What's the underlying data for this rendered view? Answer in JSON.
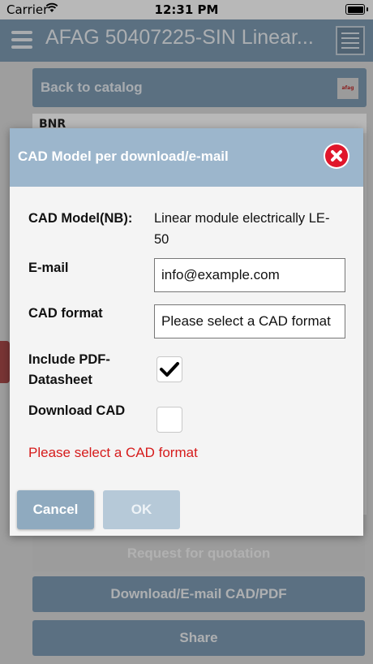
{
  "status_bar": {
    "carrier": "Carrier",
    "time": "12:31 PM",
    "wifi_icon": "wifi-icon",
    "battery_icon": "battery-icon"
  },
  "header": {
    "title": "AFAG 50407225-SIN Linear...",
    "menu_icon": "hamburger-menu-icon",
    "list_icon": "list-view-icon"
  },
  "catalog": {
    "back_label": "Back to catalog",
    "logo_text": "afag"
  },
  "table": {
    "header_label": "BNR"
  },
  "actions": {
    "quote_label": "Request for quotation",
    "download_label": "Download/E-mail CAD/PDF",
    "share_label": "Share"
  },
  "modal": {
    "title": "CAD Model per download/e-mail",
    "close_icon": "close-icon",
    "cad_model_label": "CAD Model(NB):",
    "cad_model_value": "Linear module electrically LE-50",
    "email_label": "E-mail",
    "email_value": "info@example.com",
    "cad_format_label": "CAD format",
    "cad_format_value": "Please select a CAD format",
    "include_pdf_label": "Include PDF-Datasheet",
    "include_pdf_checked": true,
    "download_cad_label": "Download CAD",
    "download_cad_checked": false,
    "error_message": "Please select a CAD format",
    "cancel_label": "Cancel",
    "ok_label": "OK"
  },
  "colors": {
    "header_blue": "#7e9bb3",
    "modal_header": "#9cb6cc",
    "error_red": "#d61b1b",
    "close_red": "#e0162b"
  }
}
